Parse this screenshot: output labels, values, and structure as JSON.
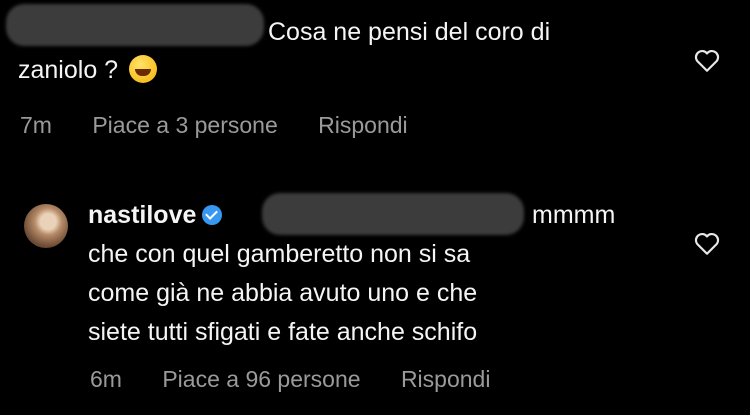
{
  "comment1": {
    "text_line1": "Cosa ne pensi del coro di",
    "text_line2": "zaniolo ?",
    "emoji": "rolling-laughing-emoji",
    "time": "7m",
    "likes": "Piace a 3 persone",
    "reply": "Rispondi"
  },
  "comment2": {
    "username": "nastilove",
    "text_line0": "mmmm",
    "text_line1": "che con quel gamberetto non si sa",
    "text_line2": "come già ne abbia avuto uno e che",
    "text_line3": "siete tutti sfigati e fate anche schifo",
    "time": "6m",
    "likes": "Piace a 96 persone",
    "reply": "Rispondi"
  },
  "colors": {
    "background": "#000000",
    "text": "#f5f5f5",
    "muted": "#9a9a9a",
    "verified": "#3897f0"
  }
}
